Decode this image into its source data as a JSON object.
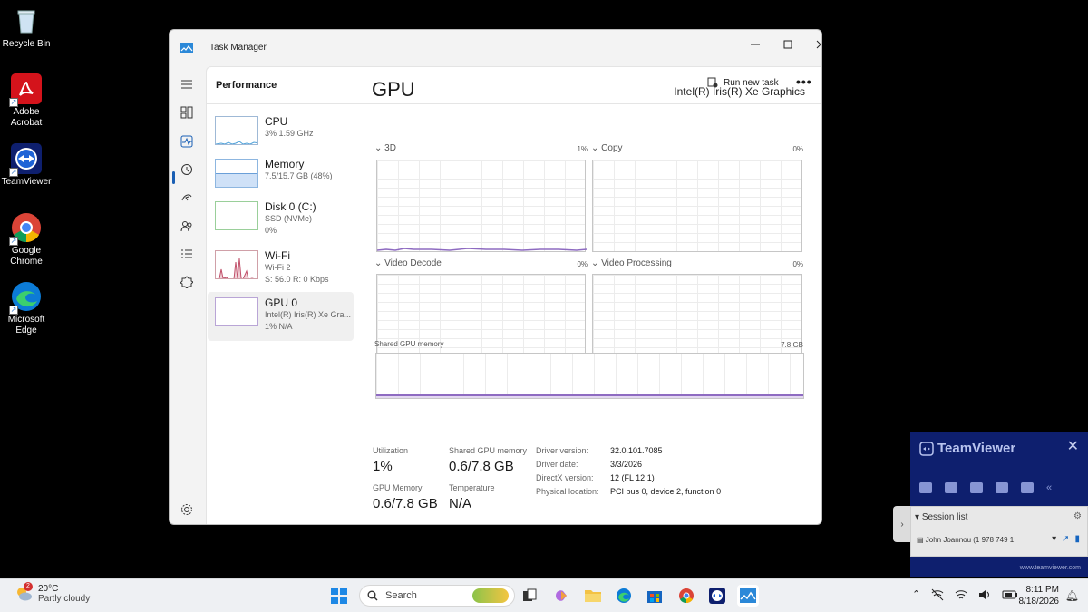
{
  "desktop": {
    "icons": [
      {
        "label": "Recycle Bin",
        "icon": "recycle-bin-icon"
      },
      {
        "label": "Adobe Acrobat",
        "icon": "adobe-acrobat-icon"
      },
      {
        "label": "TeamViewer",
        "icon": "teamviewer-icon"
      },
      {
        "label": "Google Chrome",
        "icon": "chrome-icon"
      },
      {
        "label": "Microsoft Edge",
        "icon": "edge-icon"
      }
    ]
  },
  "window": {
    "title": "Task Manager",
    "page_title": "Performance",
    "run_new_task": "Run new task",
    "more": "•••"
  },
  "resources": [
    {
      "name": "CPU",
      "sub1": "3%  1.59 GHz",
      "sub2": ""
    },
    {
      "name": "Memory",
      "sub1": "7.5/15.7 GB (48%)",
      "sub2": ""
    },
    {
      "name": "Disk 0 (C:)",
      "sub1": "SSD (NVMe)",
      "sub2": "0%"
    },
    {
      "name": "Wi-Fi",
      "sub1": "Wi-Fi 2",
      "sub2": "S: 56.0  R: 0 Kbps"
    },
    {
      "name": "GPU 0",
      "sub1": "Intel(R) Iris(R) Xe Gra...",
      "sub2": "1%  N/A"
    }
  ],
  "gpu": {
    "title": "GPU",
    "device": "Intel(R) Iris(R) Xe Graphics",
    "engines": [
      {
        "label": "3D",
        "pct": "1%"
      },
      {
        "label": "Copy",
        "pct": "0%"
      },
      {
        "label": "Video Decode",
        "pct": "0%"
      },
      {
        "label": "Video Processing",
        "pct": "0%"
      }
    ],
    "shared_label": "Shared GPU memory",
    "shared_max": "7.8 GB",
    "stats": {
      "utilization_label": "Utilization",
      "utilization": "1%",
      "shared_mem_label": "Shared GPU memory",
      "shared_mem": "0.6/7.8 GB",
      "gpu_mem_label": "GPU Memory",
      "gpu_mem": "0.6/7.8 GB",
      "temp_label": "Temperature",
      "temp": "N/A"
    },
    "info": [
      {
        "k": "Driver version:",
        "v": "32.0.101.7085"
      },
      {
        "k": "Driver date:",
        "v": "3/3/2026"
      },
      {
        "k": "DirectX version:",
        "v": "12 (FL 12.1)"
      },
      {
        "k": "Physical location:",
        "v": "PCI bus 0, device 2, function 0"
      }
    ]
  },
  "teamviewer": {
    "brand": "TeamViewer",
    "session_list": "Session list",
    "user": "John Joannou (1 978 749 1:",
    "footer": "www.teamviewer.com"
  },
  "taskbar": {
    "weather_temp": "20°C",
    "weather_desc": "Partly cloudy",
    "weather_badge": "2",
    "search_placeholder": "Search",
    "time": "8:11 PM",
    "date": "8/18/2026"
  },
  "colors": {
    "accent": "#1a5fb4",
    "tv_panel": "#0e1f6e",
    "gpu_line": "#8e6bc1",
    "cpu_line": "#4ea1d9"
  }
}
